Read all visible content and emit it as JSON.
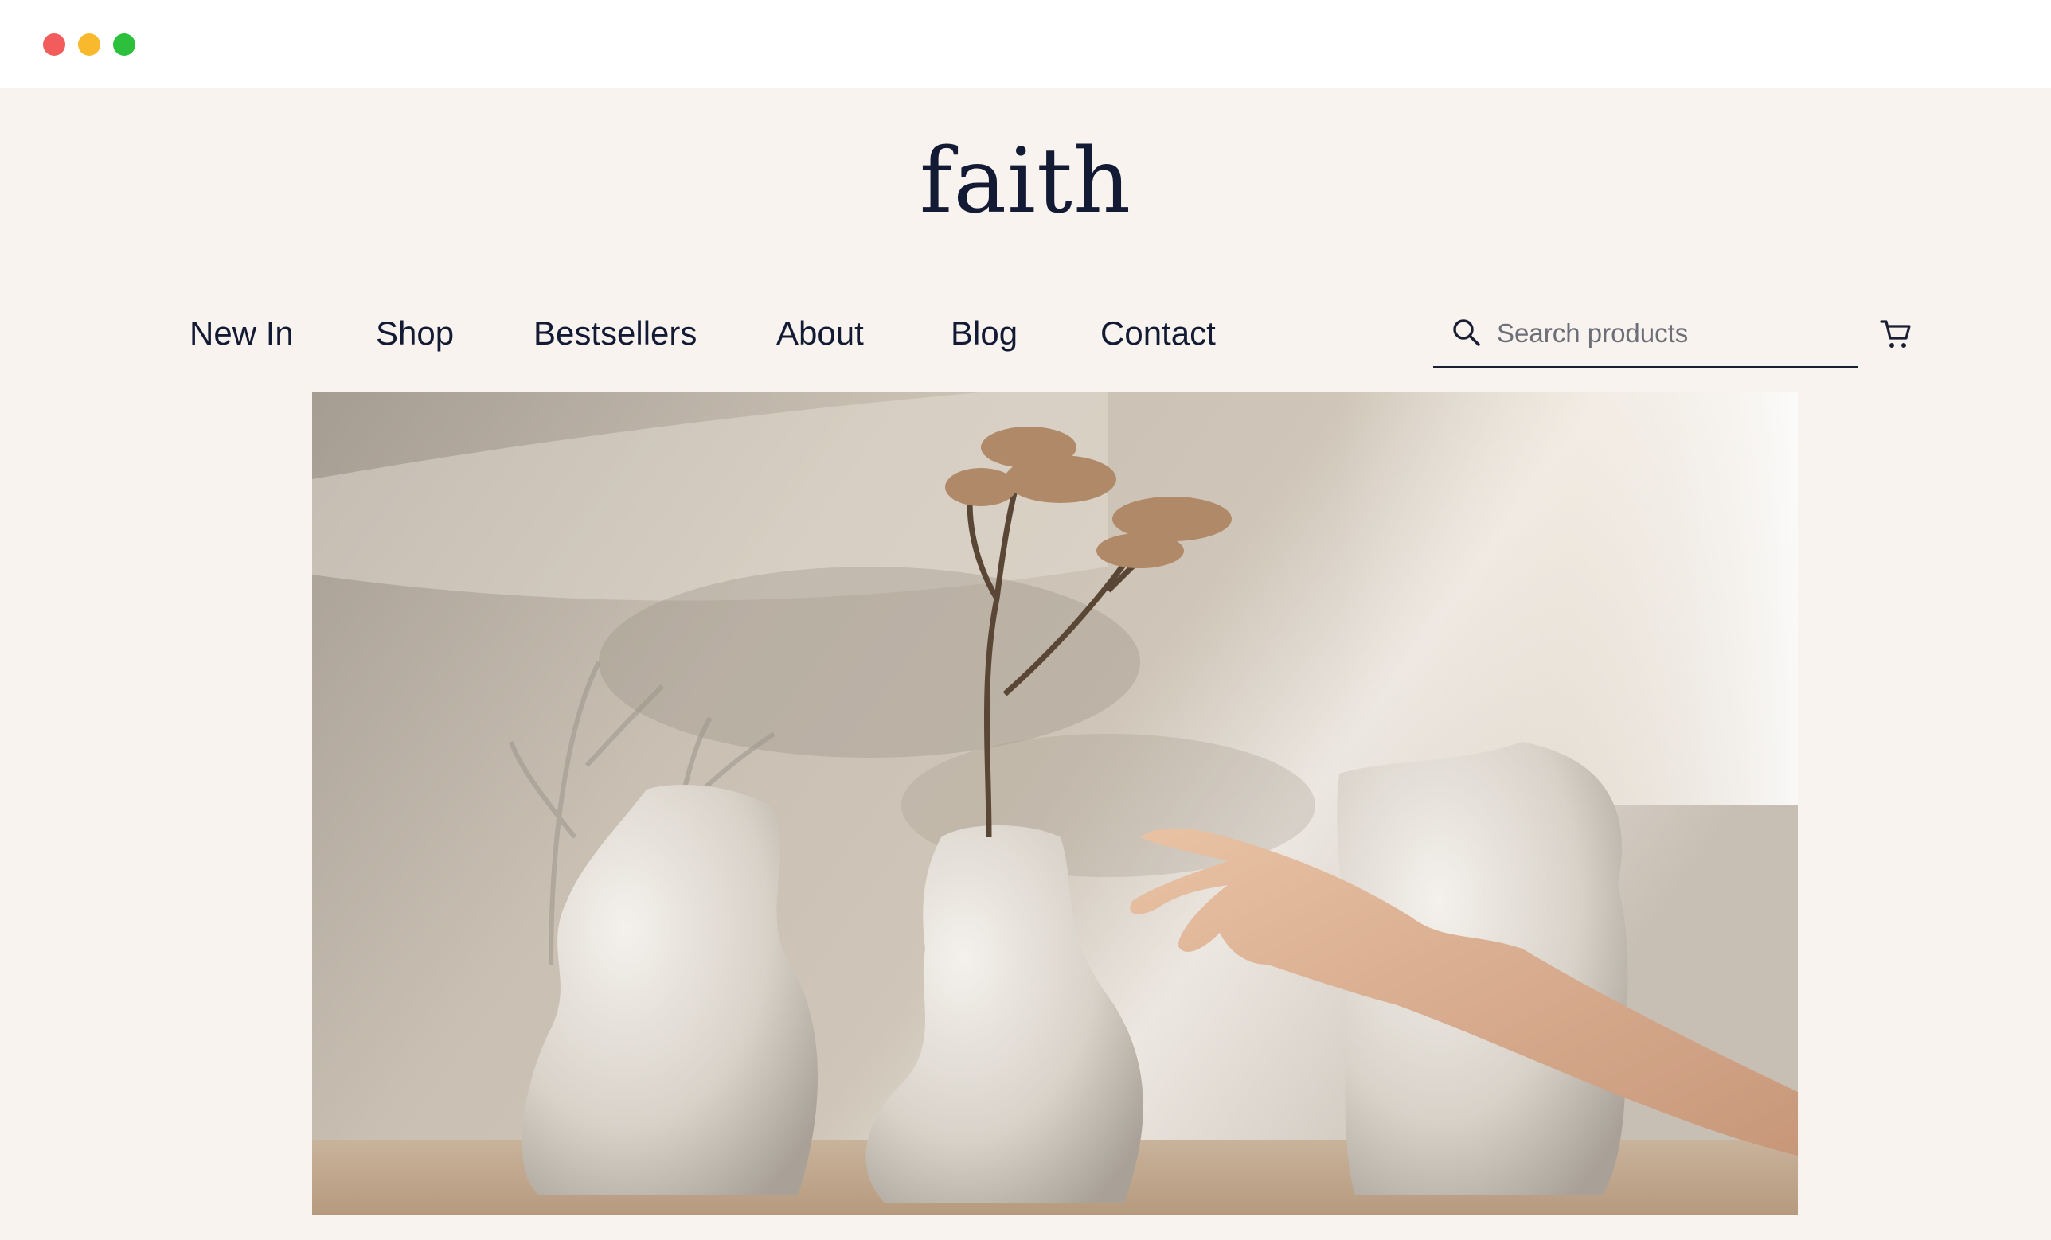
{
  "window": {
    "controls": [
      "close",
      "minimize",
      "maximize"
    ]
  },
  "brand": {
    "logo_text": "faith"
  },
  "nav": {
    "items": [
      {
        "label": "New In"
      },
      {
        "label": "Shop"
      },
      {
        "label": "Bestsellers"
      },
      {
        "label": "About"
      },
      {
        "label": "Blog"
      },
      {
        "label": "Contact"
      }
    ]
  },
  "search": {
    "placeholder": "Search products",
    "value": "",
    "icon": "search-icon"
  },
  "cart": {
    "icon": "cart-icon"
  },
  "hero": {
    "image_alt": "hero-image"
  },
  "colors": {
    "page_background": "#f8f3ef",
    "text": "#131a33"
  }
}
